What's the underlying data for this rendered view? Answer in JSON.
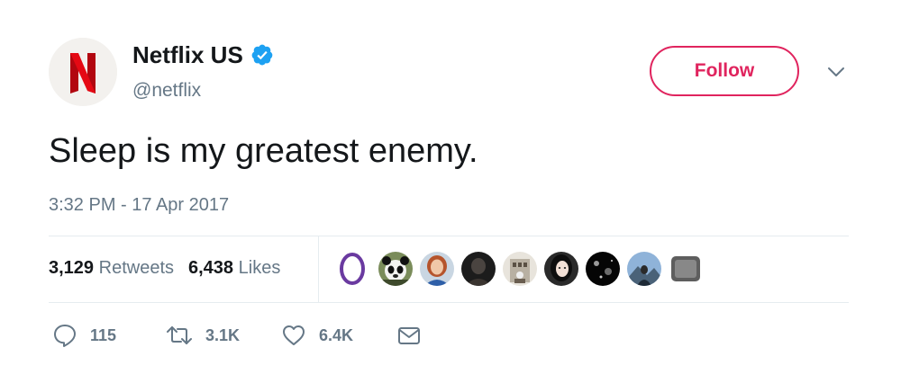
{
  "author": {
    "display_name": "Netflix US",
    "handle": "@netflix",
    "verified": true,
    "avatar_letter": "N",
    "brand_color": "#e50914"
  },
  "follow_label": "Follow",
  "tweet": {
    "text": "Sleep is my greatest enemy.",
    "timestamp": "3:32 PM - 17 Apr 2017"
  },
  "stats": {
    "retweets_count": "3,129",
    "retweets_label": "Retweets",
    "likes_count": "6,438",
    "likes_label": "Likes"
  },
  "likers": [
    "purple-ring-avatar",
    "panda-avatar",
    "woman-redhead-avatar",
    "dark-figure-avatar",
    "building-avatar",
    "woman-dark-hair-avatar",
    "space-avatar",
    "mountain-person-avatar",
    "gray-square-avatar"
  ],
  "actions": {
    "reply_count": "115",
    "retweet_count": "3.1K",
    "like_count": "6.4K"
  },
  "colors": {
    "accent_red": "#e0245e",
    "secondary_text": "#657786",
    "primary_text": "#14171a",
    "verified_blue": "#1da1f2",
    "divider": "#e6ecf0"
  }
}
